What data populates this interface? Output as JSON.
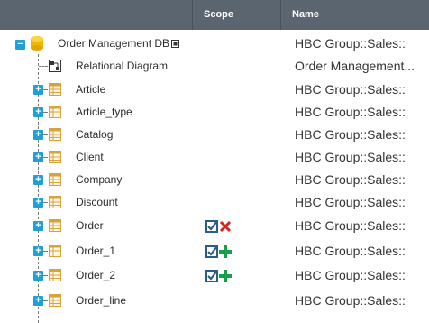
{
  "header": {
    "scope": "Scope",
    "name": "Name"
  },
  "root": {
    "label": "Order Management DB",
    "name": "HBC Group::Sales::",
    "icon": "database-icon",
    "expander": "−"
  },
  "diagram": {
    "label": "Relational Diagram",
    "name": "Order Management...",
    "icon": "diagram-icon"
  },
  "rows": [
    {
      "label": "Article",
      "name": "HBC Group::Sales::",
      "scope": ""
    },
    {
      "label": "Article_type",
      "name": "HBC Group::Sales::",
      "scope": ""
    },
    {
      "label": "Catalog",
      "name": "HBC Group::Sales::",
      "scope": ""
    },
    {
      "label": "Client",
      "name": "HBC Group::Sales::",
      "scope": ""
    },
    {
      "label": "Company",
      "name": "HBC Group::Sales::",
      "scope": ""
    },
    {
      "label": "Discount",
      "name": "HBC Group::Sales::",
      "scope": ""
    },
    {
      "label": "Order",
      "name": "HBC Group::Sales::",
      "scope": "checked-removed"
    },
    {
      "label": "Order_1",
      "name": "HBC Group::Sales::",
      "scope": "checked-added"
    },
    {
      "label": "Order_2",
      "name": "HBC Group::Sales::",
      "scope": "checked-added"
    },
    {
      "label": "Order_line",
      "name": "HBC Group::Sales::",
      "scope": ""
    }
  ],
  "expander_symbol": "+",
  "colors": {
    "header": "#5b6570",
    "expander": "#1fa0d6",
    "table_icon": "#d9a23a",
    "db_icon": "#f2b800",
    "remove": "#e0201b",
    "add": "#15a14a",
    "check": "#2a5d8a"
  }
}
